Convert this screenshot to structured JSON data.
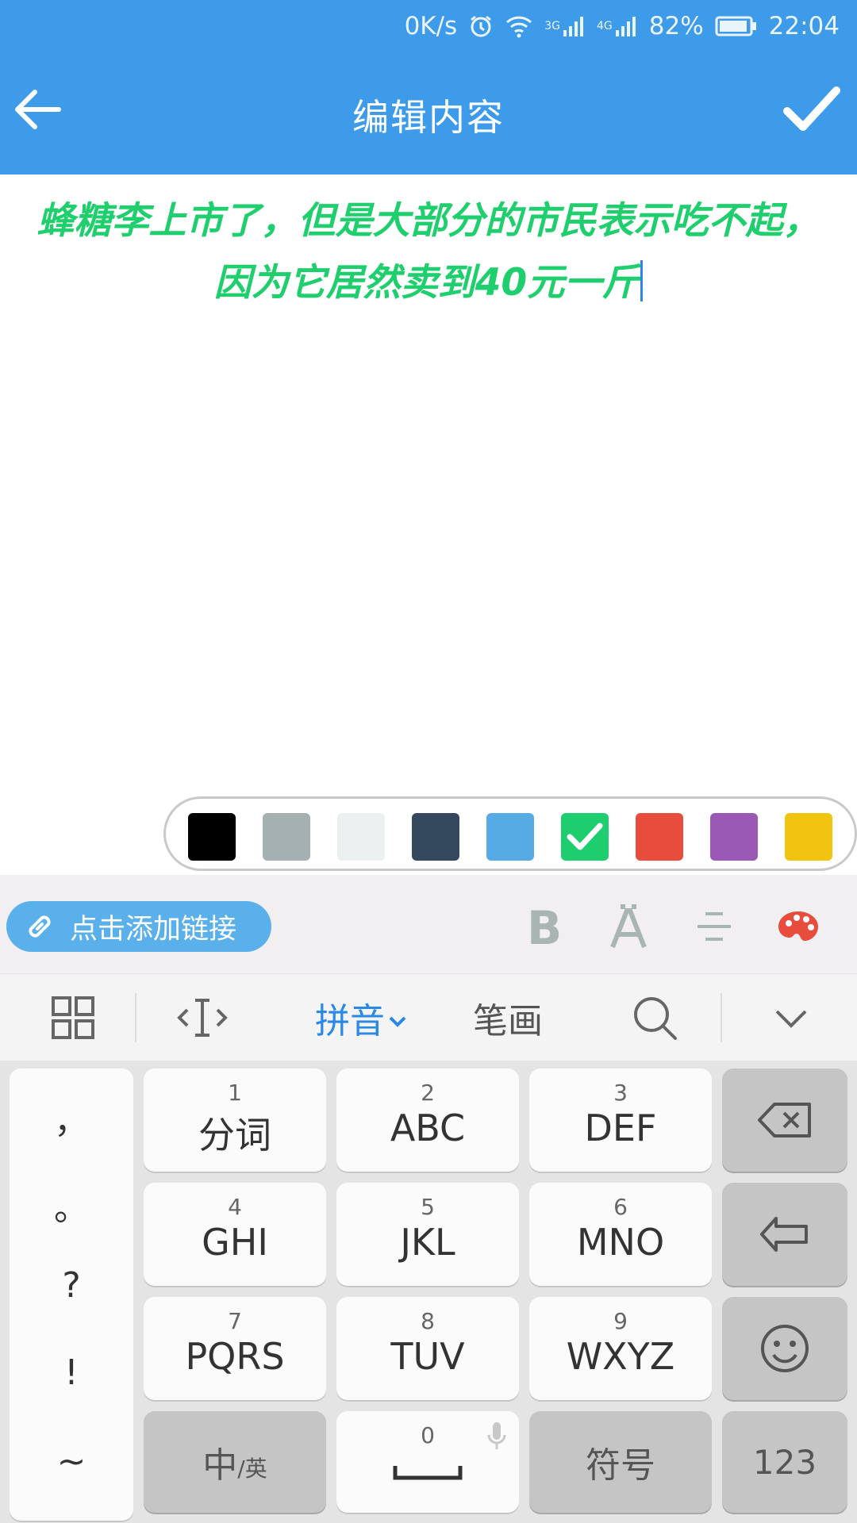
{
  "status_bar": {
    "net_speed": "0K/s",
    "signal1": "3G",
    "signal2": "4G",
    "battery": "82%",
    "time": "22:04"
  },
  "header": {
    "title": "编辑内容"
  },
  "editor": {
    "line1": "蜂糖李上市了，但是大部分的市民表示吃不起，",
    "line2": "因为它居然卖到40元一斤"
  },
  "palette": {
    "colors": [
      "#000000",
      "#a5b1b1",
      "#ecf0f1",
      "#34495e",
      "#56abe4",
      "#1ecd6d",
      "#e74c3c",
      "#9b59b6",
      "#f1c40f"
    ],
    "selected_index": 5
  },
  "format_bar": {
    "link_label": "点击添加链接"
  },
  "keyboard": {
    "top": {
      "pinyin": "拼音",
      "stroke": "笔画"
    },
    "punctuation": [
      "，",
      "。",
      "?",
      "!",
      "~"
    ],
    "keys": [
      {
        "num": "1",
        "letters": "分词"
      },
      {
        "num": "2",
        "letters": "ABC"
      },
      {
        "num": "3",
        "letters": "DEF"
      },
      {
        "num": "4",
        "letters": "GHI"
      },
      {
        "num": "5",
        "letters": "JKL"
      },
      {
        "num": "6",
        "letters": "MNO"
      },
      {
        "num": "7",
        "letters": "PQRS"
      },
      {
        "num": "8",
        "letters": "TUV"
      },
      {
        "num": "9",
        "letters": "WXYZ"
      }
    ],
    "bottom": {
      "lang_main": "中",
      "lang_sub": "/英",
      "space_num": "0",
      "symbols": "符号",
      "numbers": "123"
    }
  }
}
